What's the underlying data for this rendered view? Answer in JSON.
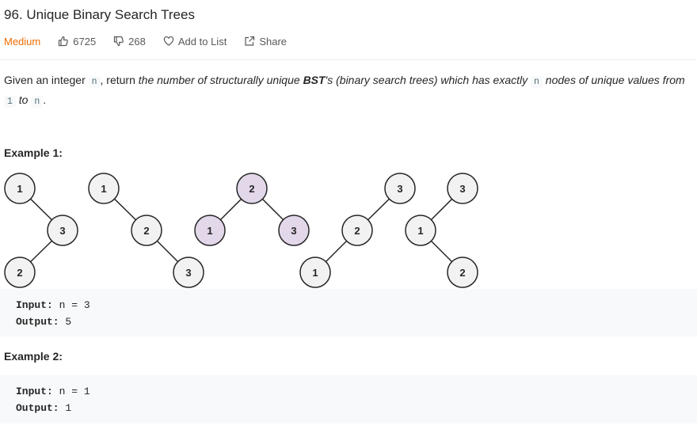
{
  "problem": {
    "title": "96. Unique Binary Search Trees",
    "difficulty": "Medium",
    "likes": "6725",
    "dislikes": "268",
    "add_to_list": "Add to List",
    "share": "Share"
  },
  "description": {
    "p1": "Given an integer ",
    "code_n": "n",
    "p2": ", return ",
    "em1": "the number of structurally unique ",
    "bst": "BST",
    "em2": "'s (binary search trees) which has exactly ",
    "code_n2": "n",
    "em3": " nodes of unique values from ",
    "code_1": "1",
    "em4": " to ",
    "code_n3": "n",
    "p3": "."
  },
  "examples": [
    {
      "title": "Example 1:",
      "input_label": "Input:",
      "input_value": " n = 3",
      "output_label": "Output:",
      "output_value": " 5",
      "trees": [
        {
          "nodes": [
            {
              "label": "1"
            },
            {
              "label": "3"
            },
            {
              "label": "2"
            }
          ]
        },
        {
          "nodes": [
            {
              "label": "1"
            },
            {
              "label": "2"
            },
            {
              "label": "3"
            }
          ]
        },
        {
          "nodes": [
            {
              "label": "2"
            },
            {
              "label": "1"
            },
            {
              "label": "3"
            }
          ]
        },
        {
          "nodes": [
            {
              "label": "3"
            },
            {
              "label": "2"
            },
            {
              "label": "1"
            }
          ]
        },
        {
          "nodes": [
            {
              "label": "3"
            },
            {
              "label": "1"
            },
            {
              "label": "2"
            }
          ]
        }
      ]
    },
    {
      "title": "Example 2:",
      "input_label": "Input:",
      "input_value": " n = 1",
      "output_label": "Output:",
      "output_value": " 1"
    }
  ],
  "colors": {
    "difficulty": "#ef6c00",
    "node_highlight": "#e3d7ea",
    "node_default": "#f2f2f2",
    "code_bg": "#f7f9fa"
  }
}
